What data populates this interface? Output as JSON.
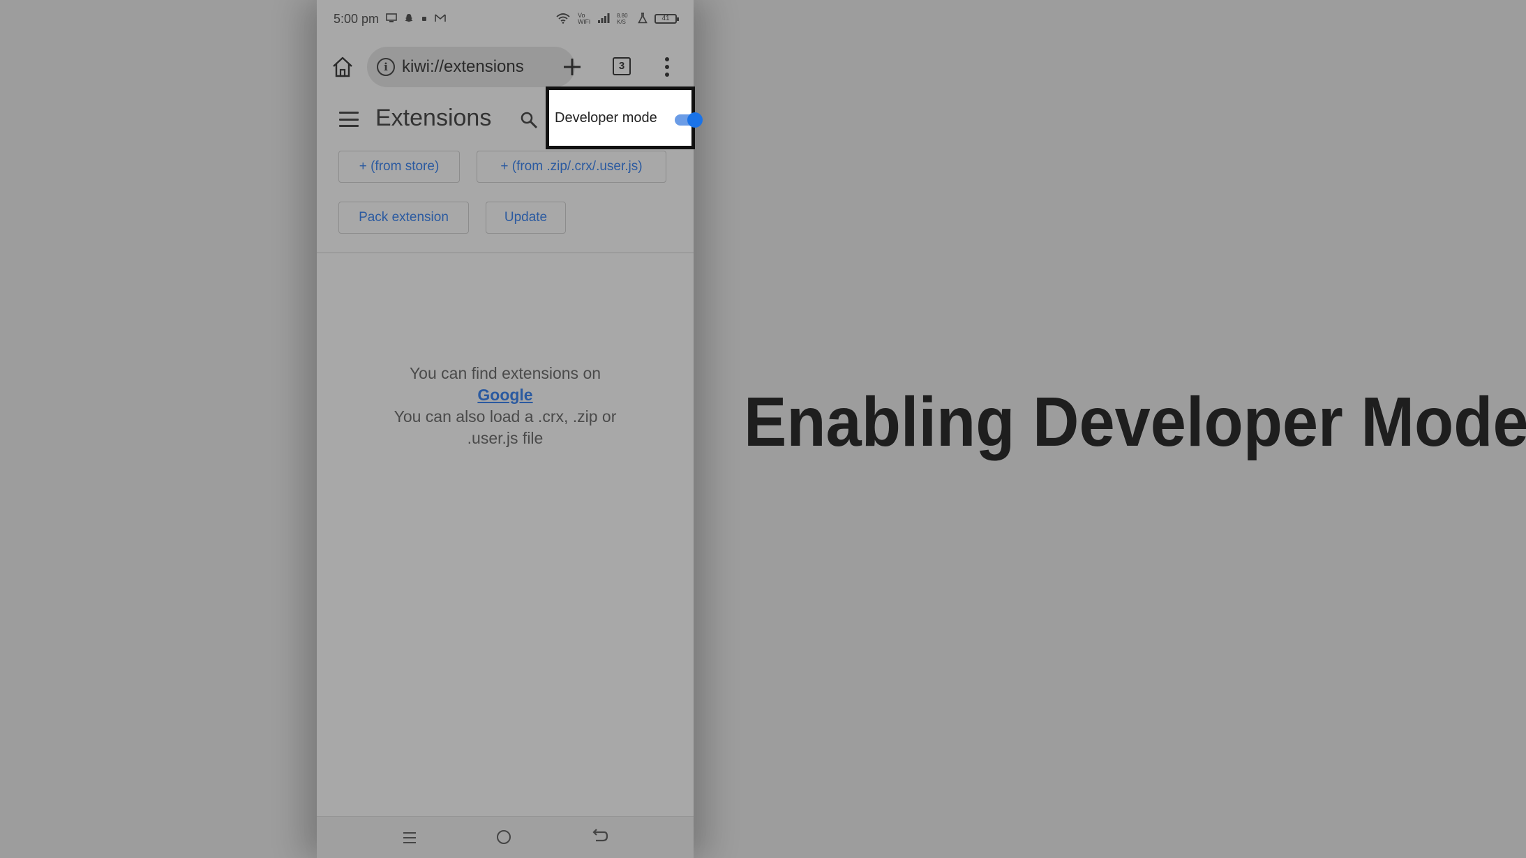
{
  "status_bar": {
    "time": "5:00 pm",
    "network_speed": "8.80 K/S",
    "vowifi": "Vo WiFi",
    "battery": "41"
  },
  "browser": {
    "url": "kiwi://extensions",
    "tab_count": "3",
    "icons": [
      "home-icon",
      "info-icon",
      "plus-icon",
      "tab-switcher-icon",
      "overflow-menu-icon"
    ]
  },
  "extensions_page": {
    "title": "Extensions",
    "developer_mode_label": "Developer mode",
    "developer_mode_enabled": true,
    "buttons": {
      "from_store": "+ (from store)",
      "from_file": "+ (from .zip/.crx/.user.js)",
      "pack": "Pack extension",
      "update": "Update"
    },
    "empty_state": {
      "line1": "You can find extensions on",
      "link": "Google",
      "line2": "You can also load a .crx, .zip or",
      "line3": ".user.js file"
    }
  },
  "overlay": {
    "caption": "Enabling Developer Mode"
  },
  "colors": {
    "accent": "#1a73e8",
    "link": "#2b5aa0",
    "dim_background": "#9d9d9d",
    "highlight_border": "#111111"
  }
}
